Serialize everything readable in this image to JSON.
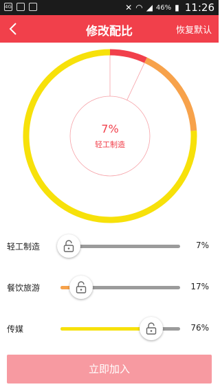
{
  "statusbar": {
    "battery": "46%",
    "time": "11:26",
    "lte": "4G"
  },
  "header": {
    "title": "修改配比",
    "reset": "恢复默认"
  },
  "ring": {
    "center_value": "7%",
    "center_label": "轻工制造",
    "segments": [
      {
        "name": "轻工制造",
        "percent": 7,
        "color": "#f1404b"
      },
      {
        "name": "餐饮旅游",
        "percent": 17,
        "color": "#f7a24b"
      },
      {
        "name": "传媒",
        "percent": 76,
        "color": "#f7e10a"
      }
    ]
  },
  "sliders": [
    {
      "label": "轻工制造",
      "value_text": "7%",
      "value": 7,
      "color": "#f1404b"
    },
    {
      "label": "餐饮旅游",
      "value_text": "17%",
      "value": 17,
      "color": "#f7a24b"
    },
    {
      "label": "传媒",
      "value_text": "76%",
      "value": 76,
      "color": "#f7e10a"
    }
  ],
  "join_button": {
    "label": "立即加入"
  }
}
